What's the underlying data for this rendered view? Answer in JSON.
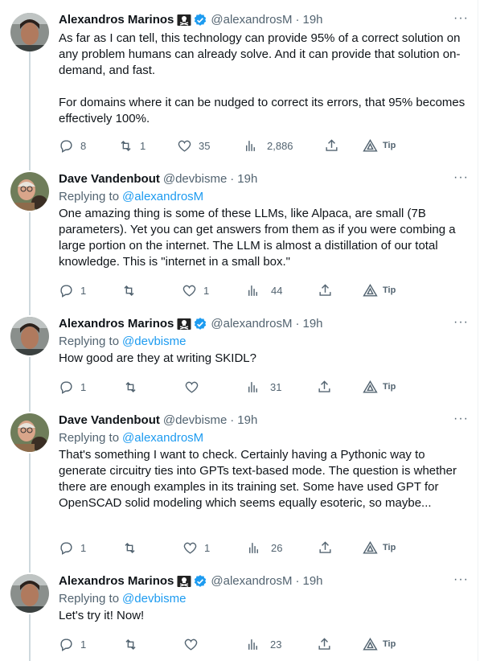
{
  "tweets": [
    {
      "author": "Alexandros Marinos",
      "handle": "@alexandrosM",
      "time": "19h",
      "badge": "pirate-flag-icon",
      "verified": true,
      "replying_to": "",
      "paragraphs": [
        "As far as I can tell, this technology can provide 95% of a correct solution on any problem humans can already solve. And it can provide that solution on-demand, and fast.",
        "For domains where it can be nudged to correct its errors, that 95% becomes effectively 100%."
      ],
      "replies": "8",
      "retweets": "1",
      "likes": "35",
      "views": "2,886",
      "tip": "Tip"
    },
    {
      "author": "Dave Vandenbout",
      "handle": "@devbisme",
      "time": "19h",
      "replying_label": "Replying to",
      "replying_to": "@alexandrosM",
      "paragraphs": [
        "One amazing thing is some of these LLMs, like Alpaca, are small (7B parameters). Yet you can get answers from them as if you were combing a large portion on the internet. The LLM is almost a distillation of our total knowledge. This is \"internet in a small box.\""
      ],
      "replies": "1",
      "retweets": "",
      "likes": "1",
      "views": "44",
      "tip": "Tip"
    },
    {
      "author": "Alexandros Marinos",
      "handle": "@alexandrosM",
      "time": "19h",
      "replying_label": "Replying to",
      "replying_to": "@devbisme",
      "paragraphs": [
        "How good are they at writing SKIDL?"
      ],
      "replies": "1",
      "retweets": "",
      "likes": "",
      "views": "31",
      "tip": "Tip"
    },
    {
      "author": "Dave Vandenbout",
      "handle": "@devbisme",
      "time": "19h",
      "replying_label": "Replying to",
      "replying_to": "@alexandrosM",
      "paragraphs": [
        "That's something I want to check. Certainly having a Pythonic way to generate circuitry ties into GPTs text-based mode. The question is whether there are enough examples in its training set. Some have used GPT for OpenSCAD solid modeling which seems equally esoteric, so maybe..."
      ],
      "replies": "1",
      "retweets": "",
      "likes": "1",
      "views": "26",
      "tip": "Tip"
    },
    {
      "author": "Alexandros Marinos",
      "handle": "@alexandrosM",
      "time": "19h",
      "replying_label": "Replying to",
      "replying_to": "@devbisme",
      "paragraphs": [
        "Let's try it! Now!"
      ],
      "replies": "1",
      "retweets": "",
      "likes": "",
      "views": "23",
      "tip": "Tip"
    }
  ],
  "separator": "·",
  "more": "···",
  "colors": {
    "accent": "#1d9bf0",
    "secondary_text": "#536471",
    "thread_line": "#cfd9de"
  }
}
